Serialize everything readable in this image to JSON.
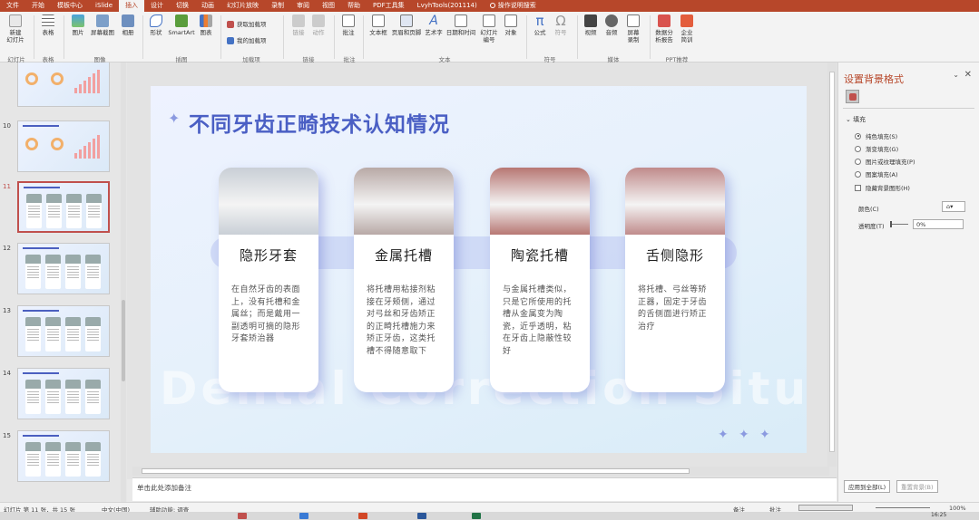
{
  "tabs": [
    {
      "label": "文件",
      "active": false
    },
    {
      "label": "开始",
      "active": false
    },
    {
      "label": "模板中心",
      "active": false
    },
    {
      "label": "iSlide",
      "active": false
    },
    {
      "label": "插入",
      "active": true
    },
    {
      "label": "设计",
      "active": false
    },
    {
      "label": "切换",
      "active": false
    },
    {
      "label": "动画",
      "active": false
    },
    {
      "label": "幻灯片放映",
      "active": false
    },
    {
      "label": "录制",
      "active": false
    },
    {
      "label": "审阅",
      "active": false
    },
    {
      "label": "视图",
      "active": false
    },
    {
      "label": "帮助",
      "active": false
    },
    {
      "label": "PDF工具集",
      "active": false
    },
    {
      "label": "LvyhTools(201114)",
      "active": false
    },
    {
      "label": "操作说明搜索",
      "active": false
    }
  ],
  "ribbon": {
    "new_slide": "新建\n幻灯片",
    "table": "表格",
    "picture": "图片",
    "screenshot": "屏幕截图",
    "album": "相册",
    "shapes": "形状",
    "smartart": "SmartArt",
    "chart": "图表",
    "get_addins": "获取加载项",
    "my_addins": "我的加载项",
    "link": "链接",
    "action": "动作",
    "comment": "批注",
    "textbox": "文本框",
    "header_footer": "页眉和页脚",
    "wordart": "艺术字",
    "datetime": "日期和时间",
    "slide_number": "幻灯片\n编号",
    "object": "对象",
    "equation": "公式",
    "symbol": "符号",
    "video": "视频",
    "audio": "音频",
    "screen_record": "屏幕\n录制",
    "data_report": "数据分\n析报告",
    "enterprise": "企业\n简训",
    "groups": {
      "slides": "幻灯片",
      "tables": "表格",
      "images": "图像",
      "illustrations": "插图",
      "addins": "加载项",
      "links": "链接",
      "comments": "批注",
      "text": "文本",
      "symbols": "符号",
      "media": "媒体",
      "ppt": "PPT推荐"
    }
  },
  "thumbnails": [
    {
      "number": "",
      "kind": "chart"
    },
    {
      "number": "10",
      "kind": "chart"
    },
    {
      "number": "11",
      "kind": "cards"
    },
    {
      "number": "12",
      "kind": "cards"
    },
    {
      "number": "13",
      "kind": "cards"
    },
    {
      "number": "14",
      "kind": "cards"
    },
    {
      "number": "15",
      "kind": "cards"
    }
  ],
  "slide": {
    "title": "不同牙齿正畸技术认知情况",
    "watermark": "Dental Correction Situation St",
    "cards": [
      {
        "title": "隐形牙套",
        "body": "在自然牙齿的表面上，没有托槽和金属丝；而是戴用一副透明可摘的隐形牙套矫治器",
        "img": "#c9cfd6"
      },
      {
        "title": "金属托槽",
        "body": "将托槽用粘接剂粘接在牙颊侧，通过对弓丝和牙齿矫正的正畸托槽施力来矫正牙齿，这类托槽不得随意取下",
        "img": "#b8a9a6"
      },
      {
        "title": "陶瓷托槽",
        "body": "与金属托槽类似，只是它所使用的托槽从金属变为陶瓷，近乎透明，粘在牙齿上隐蔽性较好",
        "img": "#b77773"
      },
      {
        "title": "舌侧隐形",
        "body": "将托槽、弓丝等矫正器，固定于牙齿的舌侧面进行矫正治疗",
        "img": "#c08b8b"
      }
    ]
  },
  "notes": {
    "placeholder": "单击此处添加备注"
  },
  "pane": {
    "title": "设置背景格式",
    "fill_section": "填充",
    "options": [
      {
        "label": "纯色填充(S)",
        "checked": true
      },
      {
        "label": "渐变填充(G)",
        "checked": false
      },
      {
        "label": "图片或纹理填充(P)",
        "checked": false
      },
      {
        "label": "图案填充(A)",
        "checked": false
      }
    ],
    "hide_bg": "隐藏背景图形(H)",
    "color_label": "颜色(C)",
    "transparency_label": "透明度(T)",
    "transparency_value": "0%",
    "apply_all": "应用到全部(L)",
    "reset": "重置背景(B)"
  },
  "status": {
    "slide_info": "幻灯片 第 11 张，共 15 张",
    "language": "中文(中国)",
    "accessibility": "辅助功能: 调查",
    "notes_btn": "备注",
    "comments_btn": "批注",
    "zoom": "100%",
    "time": "16:25"
  },
  "colors": {
    "accent": "#b7472a",
    "title": "#4a5fc4",
    "selected_thumb": "#c0504d"
  }
}
